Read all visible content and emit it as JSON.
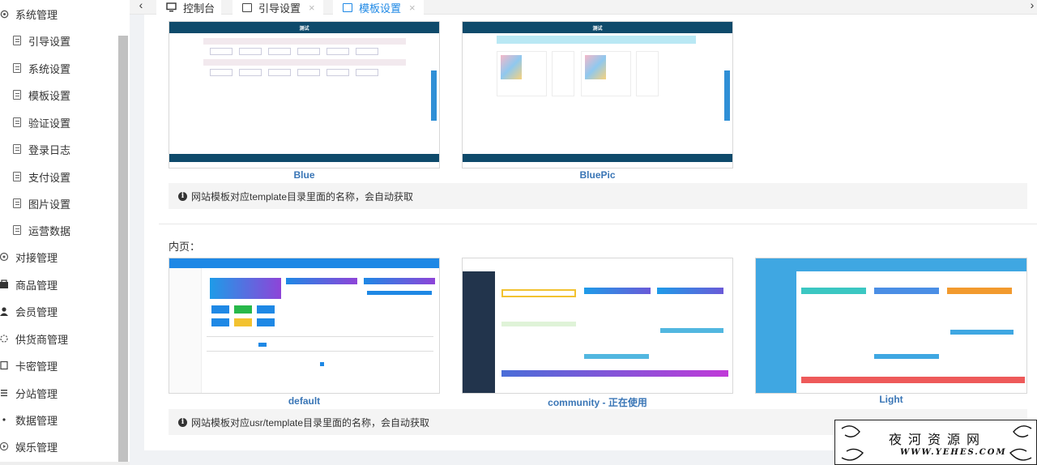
{
  "sidebar": {
    "items": [
      {
        "label": "系统管理",
        "level": "top",
        "icon": "gear-icon"
      },
      {
        "label": "引导设置",
        "level": "sub",
        "icon": "document-icon"
      },
      {
        "label": "系统设置",
        "level": "sub",
        "icon": "document-icon"
      },
      {
        "label": "模板设置",
        "level": "sub",
        "icon": "document-icon"
      },
      {
        "label": "验证设置",
        "level": "sub",
        "icon": "document-icon"
      },
      {
        "label": "登录日志",
        "level": "sub",
        "icon": "document-icon"
      },
      {
        "label": "支付设置",
        "level": "sub",
        "icon": "document-icon"
      },
      {
        "label": "图片设置",
        "level": "sub",
        "icon": "document-icon"
      },
      {
        "label": "运营数据",
        "level": "sub",
        "icon": "document-icon"
      },
      {
        "label": "对接管理",
        "level": "top",
        "icon": "link-icon"
      },
      {
        "label": "商品管理",
        "level": "top",
        "icon": "goods-icon"
      },
      {
        "label": "会员管理",
        "level": "top",
        "icon": "user-icon"
      },
      {
        "label": "供货商管理",
        "level": "top",
        "icon": "supplier-icon"
      },
      {
        "label": "卡密管理",
        "level": "top",
        "icon": "card-icon"
      },
      {
        "label": "分站管理",
        "level": "top",
        "icon": "list-icon"
      },
      {
        "label": "数据管理",
        "level": "top",
        "icon": "dot-icon"
      },
      {
        "label": "娱乐管理",
        "level": "top",
        "icon": "play-icon"
      }
    ]
  },
  "tabs": [
    {
      "label": "控制台",
      "closable": false,
      "active": false,
      "icon": "monitor-icon"
    },
    {
      "label": "引导设置",
      "closable": true,
      "active": false,
      "icon": "document-icon"
    },
    {
      "label": "模板设置",
      "closable": true,
      "active": true,
      "icon": "document-icon"
    }
  ],
  "tab_close_glyph": "×",
  "tab_prev_glyph": "‹",
  "tab_next_glyph": "›",
  "site_templates": [
    {
      "name": "Blue",
      "preview_title": "测试"
    },
    {
      "name": "BluePic",
      "preview_title": "测试"
    }
  ],
  "site_note": "网站模板对应template目录里面的名称，会自动获取",
  "inner_section_title": "内页：",
  "inner_templates": [
    {
      "name": "default"
    },
    {
      "name": "community - 正在使用"
    },
    {
      "name": "Light"
    }
  ],
  "inner_note": "网站模板对应usr/template目录里面的名称，会自动获取",
  "info_glyph": "i",
  "watermark": {
    "title": "夜河资源网",
    "url": "WWW.YEHES.COM"
  },
  "colors": {
    "accent": "#1e88e5",
    "caption": "#3a76b6",
    "blue_header": "#0e4a6b"
  }
}
